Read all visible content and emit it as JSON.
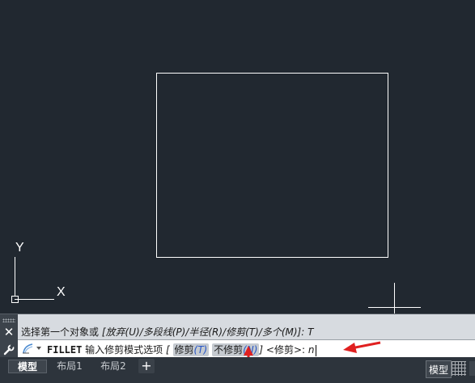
{
  "ucs": {
    "y_label": "Y",
    "x_label": "X"
  },
  "command": {
    "history_prefix": "选择第一个对象或 ",
    "history_options": "[放弃(U)/多段线(P)/半径(R)/修剪(T)/多个(M)]: T",
    "command_name": "FILLET",
    "prompt_text": " 输入修剪模式选项 ",
    "bracket_open": "[",
    "option_trim_label": "修剪",
    "option_trim_key": "(T)",
    "option_notrim_label": "不修剪",
    "option_notrim_key": "(N)",
    "bracket_close": "]",
    "default_value": " <修剪>: ",
    "typed_value": "n"
  },
  "tabs": [
    {
      "label": "模型",
      "active": true
    },
    {
      "label": "布局1",
      "active": false
    },
    {
      "label": "布局2",
      "active": false
    }
  ],
  "add_tab_label": "+",
  "status": {
    "model_label": "模型"
  },
  "colors": {
    "canvas": "#212830",
    "annotation_arrow": "#e02020",
    "option_key": "#2554c7"
  },
  "icons": [
    "close-icon",
    "wrench-icon",
    "command-icon",
    "grid-icon"
  ]
}
